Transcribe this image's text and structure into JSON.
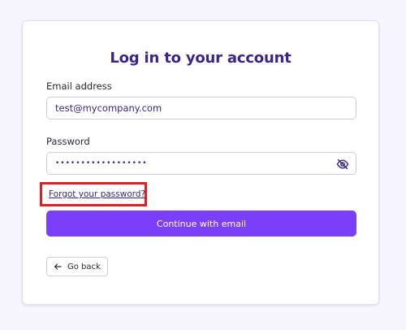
{
  "form": {
    "title": "Log in to your account",
    "email_label": "Email address",
    "email_value": "test@mycompany.com",
    "password_label": "Password",
    "password_value": "••••••••••••••••••",
    "forgot_link": "Forgot your password?",
    "submit_label": "Continue with email",
    "back_label": "Go back"
  },
  "icons": {
    "password_toggle": "eye-off-icon",
    "back": "arrow-left-icon"
  },
  "colors": {
    "brand_primary": "#7b3ff7",
    "heading": "#3b2687",
    "highlight": "#e41d22",
    "background": "#f7f5fd"
  }
}
